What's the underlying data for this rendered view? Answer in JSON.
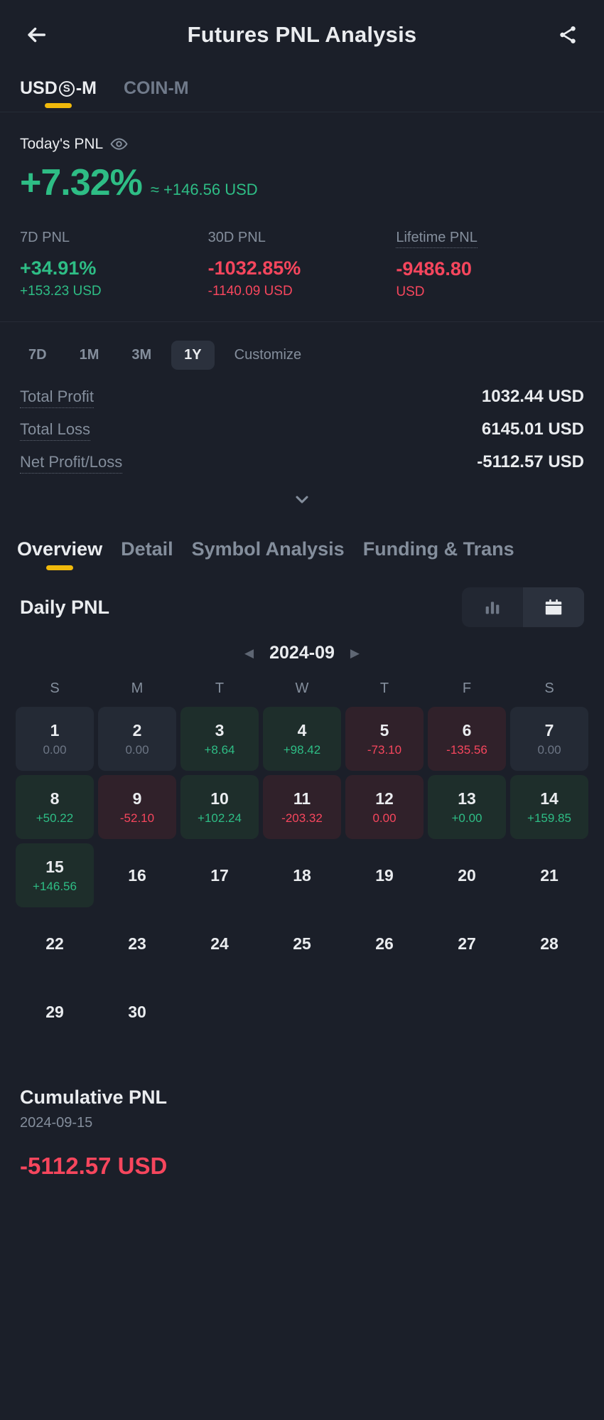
{
  "appbar": {
    "back_icon": "arrow-left-icon",
    "title": "Futures PNL Analysis",
    "share_icon": "share-icon"
  },
  "mode_tabs": [
    {
      "label_pre": "USD",
      "label_mid": "S",
      "label_post": "-M",
      "active": true
    },
    {
      "label": "COIN-M",
      "active": false
    }
  ],
  "today": {
    "label": "Today's PNL",
    "eye_icon": "eye-icon",
    "percent": "+7.32%",
    "approx": "≈ +146.56 USD",
    "cards": [
      {
        "label": "7D PNL",
        "percent": "+34.91%",
        "usd": "+153.23 USD",
        "direction": "up",
        "dotted": false
      },
      {
        "label": "30D PNL",
        "percent": "-1032.85%",
        "usd": "-1140.09 USD",
        "direction": "down",
        "dotted": false
      },
      {
        "label": "Lifetime PNL",
        "percent": "-9486.80",
        "usd": "USD",
        "direction": "down",
        "dotted": true
      }
    ]
  },
  "range_filter": {
    "options": [
      {
        "label": "7D",
        "active": false
      },
      {
        "label": "1M",
        "active": false
      },
      {
        "label": "3M",
        "active": false
      },
      {
        "label": "1Y",
        "active": true
      },
      {
        "label": "Customize",
        "active": false,
        "plain": true
      }
    ]
  },
  "totals": [
    {
      "label": "Total Profit",
      "value": "1032.44 USD"
    },
    {
      "label": "Total Loss",
      "value": "6145.01 USD"
    },
    {
      "label": "Net Profit/Loss",
      "value": "-5112.57 USD"
    }
  ],
  "expander_icon": "chevron-down-icon",
  "section_tabs": [
    {
      "label": "Overview",
      "active": true
    },
    {
      "label": "Detail",
      "active": false
    },
    {
      "label": "Symbol Analysis",
      "active": false
    },
    {
      "label": "Funding & Trans",
      "active": false
    }
  ],
  "daily_pnl": {
    "title": "Daily PNL",
    "view_toggle": [
      {
        "icon": "bar-chart-icon",
        "active": false
      },
      {
        "icon": "calendar-icon",
        "active": true
      }
    ],
    "month": "2024-09",
    "prev_icon": "caret-left-icon",
    "next_icon": "caret-right-icon",
    "weekdays": [
      "S",
      "M",
      "T",
      "W",
      "T",
      "F",
      "S"
    ],
    "weeks": [
      [
        {
          "day": "1",
          "value": "0.00",
          "state": "zero"
        },
        {
          "day": "2",
          "value": "0.00",
          "state": "zero"
        },
        {
          "day": "3",
          "value": "+8.64",
          "state": "pos"
        },
        {
          "day": "4",
          "value": "+98.42",
          "state": "pos"
        },
        {
          "day": "5",
          "value": "-73.10",
          "state": "neg"
        },
        {
          "day": "6",
          "value": "-135.56",
          "state": "neg"
        },
        {
          "day": "7",
          "value": "0.00",
          "state": "zero"
        }
      ],
      [
        {
          "day": "8",
          "value": "+50.22",
          "state": "pos"
        },
        {
          "day": "9",
          "value": "-52.10",
          "state": "neg"
        },
        {
          "day": "10",
          "value": "+102.24",
          "state": "pos"
        },
        {
          "day": "11",
          "value": "-203.32",
          "state": "neg"
        },
        {
          "day": "12",
          "value": "0.00",
          "state": "negzero"
        },
        {
          "day": "13",
          "value": "+0.00",
          "state": "pos"
        },
        {
          "day": "14",
          "value": "+159.85",
          "state": "pos"
        }
      ],
      [
        {
          "day": "15",
          "value": "+146.56",
          "state": "pos"
        },
        {
          "day": "16",
          "value": "",
          "state": "empty"
        },
        {
          "day": "17",
          "value": "",
          "state": "empty"
        },
        {
          "day": "18",
          "value": "",
          "state": "empty"
        },
        {
          "day": "19",
          "value": "",
          "state": "empty"
        },
        {
          "day": "20",
          "value": "",
          "state": "empty"
        },
        {
          "day": "21",
          "value": "",
          "state": "empty"
        }
      ],
      [
        {
          "day": "22",
          "value": "",
          "state": "empty"
        },
        {
          "day": "23",
          "value": "",
          "state": "empty"
        },
        {
          "day": "24",
          "value": "",
          "state": "empty"
        },
        {
          "day": "25",
          "value": "",
          "state": "empty"
        },
        {
          "day": "26",
          "value": "",
          "state": "empty"
        },
        {
          "day": "27",
          "value": "",
          "state": "empty"
        },
        {
          "day": "28",
          "value": "",
          "state": "empty"
        }
      ],
      [
        {
          "day": "29",
          "value": "",
          "state": "empty"
        },
        {
          "day": "30",
          "value": "",
          "state": "empty"
        },
        {
          "day": "",
          "value": "",
          "state": "blank"
        },
        {
          "day": "",
          "value": "",
          "state": "blank"
        },
        {
          "day": "",
          "value": "",
          "state": "blank"
        },
        {
          "day": "",
          "value": "",
          "state": "blank"
        },
        {
          "day": "",
          "value": "",
          "state": "blank"
        }
      ]
    ]
  },
  "cumulative": {
    "title": "Cumulative PNL",
    "date": "2024-09-15",
    "value": "-5112.57 USD"
  },
  "colors": {
    "background": "#1b1f29",
    "accent": "#f0b90b",
    "up": "#2ebd85",
    "down": "#f6465d",
    "text_primary": "#eaecef",
    "text_secondary": "#848e9c"
  }
}
